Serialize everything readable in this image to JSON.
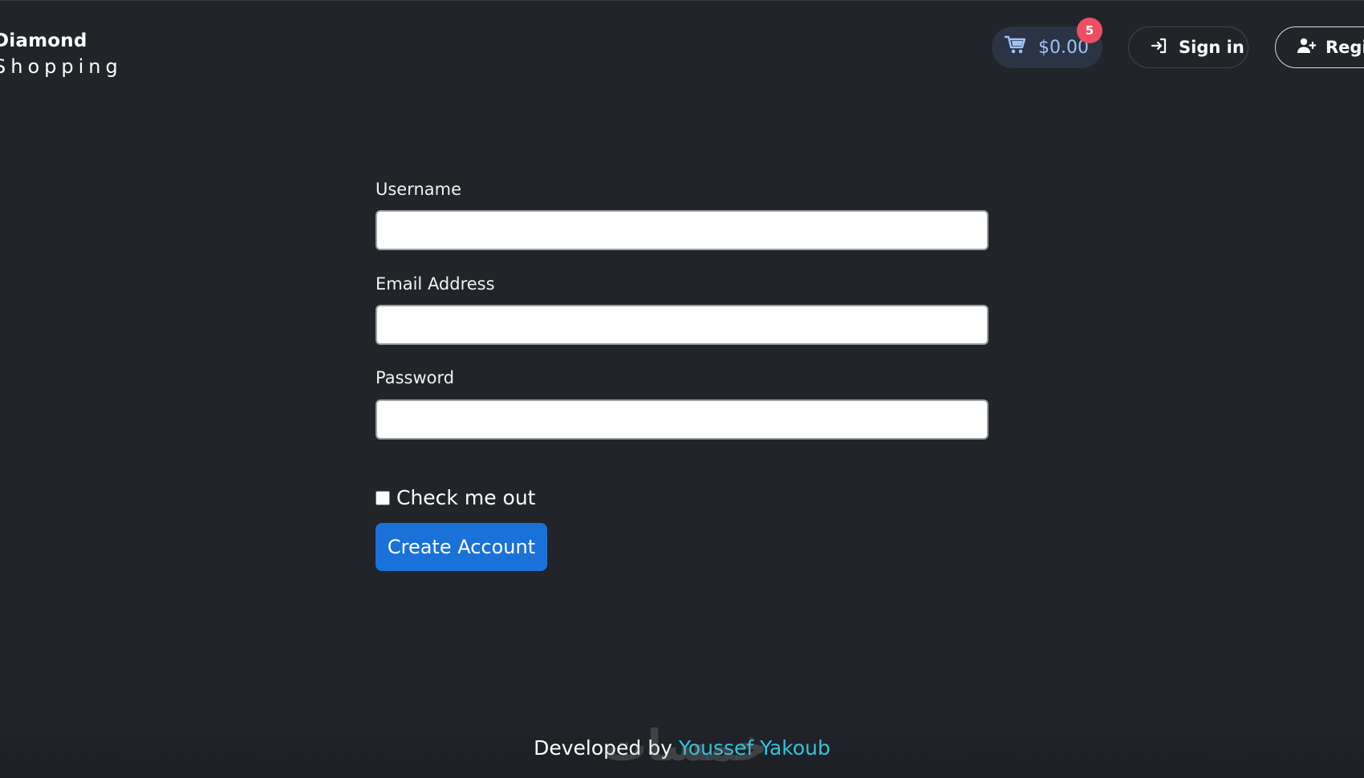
{
  "header": {
    "brand_line1": "Diamond",
    "brand_line2": "Shopping",
    "cart": {
      "amount": "$0.00",
      "badge_count": "5",
      "icon": "cart-icon"
    },
    "signin": {
      "label": "Sign in",
      "icon": "sign-in-icon"
    },
    "register": {
      "label": "Register",
      "icon": "user-plus-icon"
    }
  },
  "form": {
    "username_label": "Username",
    "username_value": "",
    "email_label": "Email Address",
    "email_value": "",
    "password_label": "Password",
    "password_value": "",
    "checkbox_label": "Check me out",
    "checkbox_checked": false,
    "submit_label": "Create Account"
  },
  "footer": {
    "prefix": "Developed by",
    "author": "Youssef Yakoub",
    "watermark": "خمسات"
  },
  "colors": {
    "background": "#212429",
    "primary_button": "#1a72d8",
    "badge": "#ef4d64",
    "link": "#2fc5e0",
    "cart_text": "#9ec3f5"
  }
}
